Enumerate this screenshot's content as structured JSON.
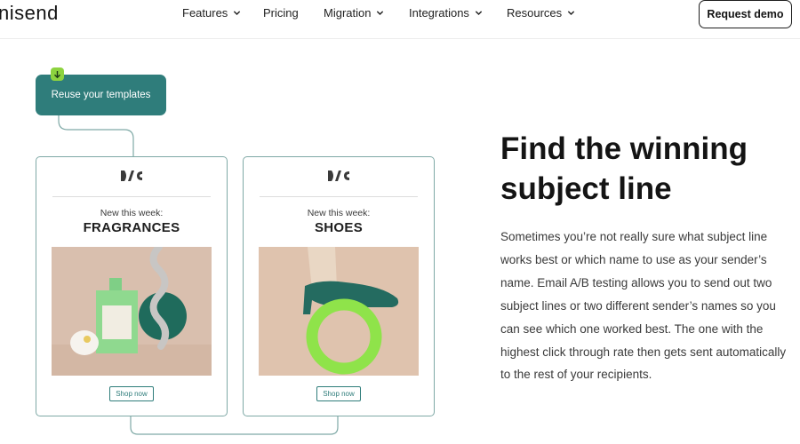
{
  "nav": {
    "logo": "nisend",
    "items": [
      {
        "label": "Features",
        "has_dropdown": true
      },
      {
        "label": "Pricing",
        "has_dropdown": false
      },
      {
        "label": "Migration",
        "has_dropdown": true
      },
      {
        "label": "Integrations",
        "has_dropdown": true
      },
      {
        "label": "Resources",
        "has_dropdown": true
      }
    ],
    "cta_label": "Request demo"
  },
  "illustration": {
    "reuse_label": "Reuse your templates",
    "badge_icon": "download-arrow-icon",
    "cards": [
      {
        "kicker": "New this week:",
        "title": "FRAGRANCES",
        "button": "Shop now",
        "image_icon": "perfume-bottle-icon"
      },
      {
        "kicker": "New this week:",
        "title": "SHOES",
        "button": "Shop now",
        "image_icon": "shoe-on-ring-icon"
      }
    ]
  },
  "content": {
    "headline": "Find the winning subject line",
    "body": "Sometimes you’re not really sure what subject line works best or which name to use as your sender’s name. Email A/B testing allows you to send out two subject lines or two different sender’s names so you can see which one worked best. The one with the highest click through rate then gets sent automatically to the rest of your recipients."
  },
  "colors": {
    "accent": "#2f7d7b",
    "badge": "#8dd33f",
    "card_border": "#7fa9a6"
  }
}
